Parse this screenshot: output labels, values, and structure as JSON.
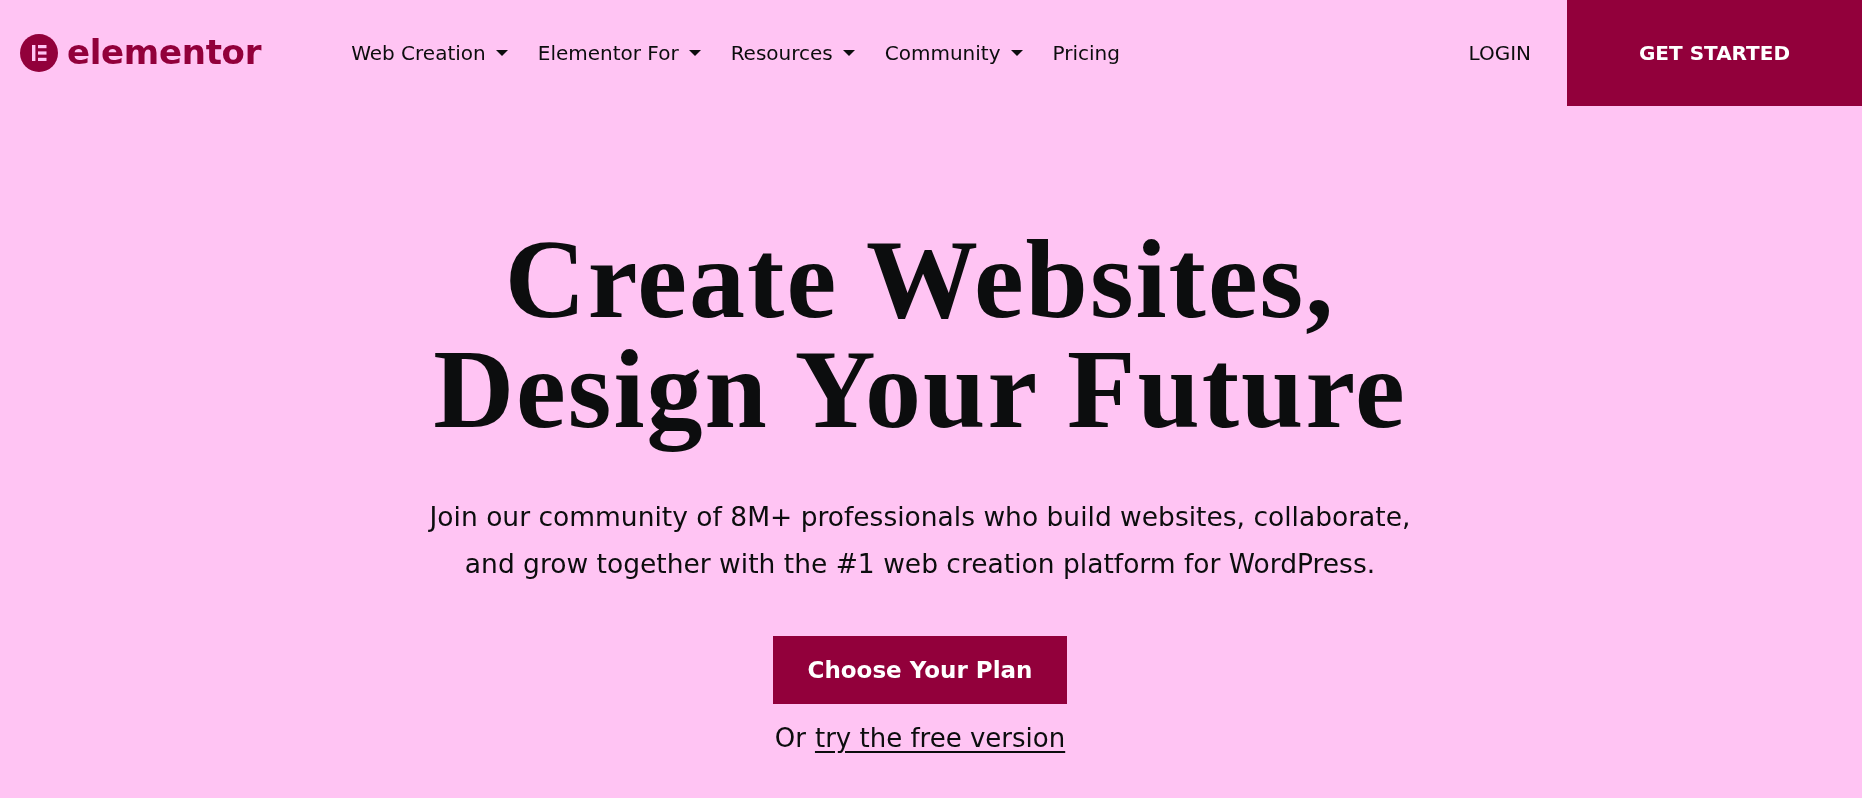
{
  "header": {
    "logo": {
      "text": "elementor"
    },
    "nav": [
      {
        "label": "Web Creation",
        "dropdown": true
      },
      {
        "label": "Elementor For",
        "dropdown": true
      },
      {
        "label": "Resources",
        "dropdown": true
      },
      {
        "label": "Community",
        "dropdown": true
      },
      {
        "label": "Pricing",
        "dropdown": false
      }
    ],
    "login": "LOGIN",
    "cta": "GET STARTED"
  },
  "hero": {
    "title": "Create Websites, Design Your Future",
    "subtitle": "Join our community of 8M+ professionals who build websites, collaborate, and grow together with the #1 web creation platform for WordPress.",
    "primary_button": "Choose Your Plan",
    "alt_prefix": "Or",
    "alt_link": "try the free version"
  }
}
